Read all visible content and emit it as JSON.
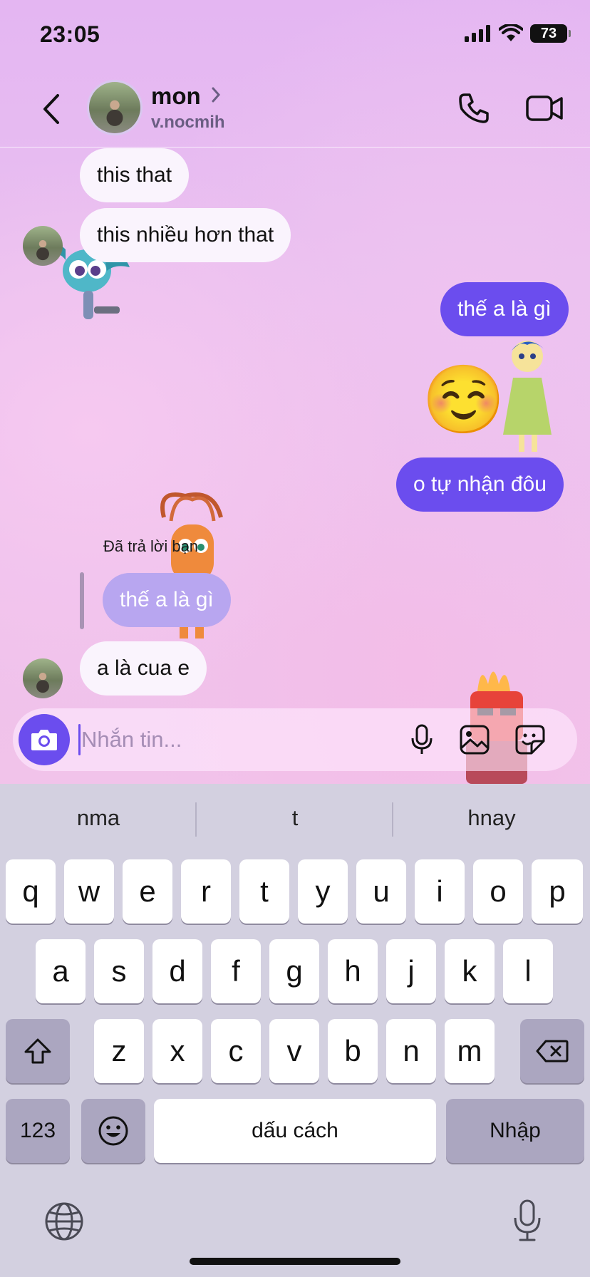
{
  "status_bar": {
    "time": "23:05",
    "battery": "73"
  },
  "header": {
    "name": "mon",
    "handle": "v.nocmih"
  },
  "messages": [
    {
      "side": "in",
      "text": "this that"
    },
    {
      "side": "in",
      "text": "this nhiều hơn that"
    },
    {
      "side": "out",
      "text": "thế a là gì"
    },
    {
      "side": "out",
      "emoji": "☺️"
    },
    {
      "side": "out",
      "text": "o tự nhận đôu"
    },
    {
      "side": "in",
      "reply_caption": "Đã trả lời bạn",
      "replied_text": "thế a là gì",
      "text": "a là cua e"
    }
  ],
  "composer": {
    "placeholder": "Nhắn tin..."
  },
  "keyboard": {
    "suggestions": [
      "nma",
      "t",
      "hnay"
    ],
    "row1": [
      "q",
      "w",
      "e",
      "r",
      "t",
      "y",
      "u",
      "i",
      "o",
      "p"
    ],
    "row2": [
      "a",
      "s",
      "d",
      "f",
      "g",
      "h",
      "j",
      "k",
      "l"
    ],
    "row3": [
      "z",
      "x",
      "c",
      "v",
      "b",
      "n",
      "m"
    ],
    "numbers_key": "123",
    "space_key": "dấu cách",
    "return_key": "Nhập"
  },
  "colors": {
    "accent": "#6b4dee",
    "incoming_bubble": "#faf4fd",
    "keyboard_bg": "#d3d0e0"
  },
  "icons": [
    "back-icon",
    "chevron-right-icon",
    "phone-icon",
    "video-camera-icon",
    "camera-icon",
    "microphone-icon",
    "image-icon",
    "sticker-icon",
    "shift-icon",
    "backspace-icon",
    "emoji-icon",
    "globe-icon",
    "dictation-icon"
  ]
}
